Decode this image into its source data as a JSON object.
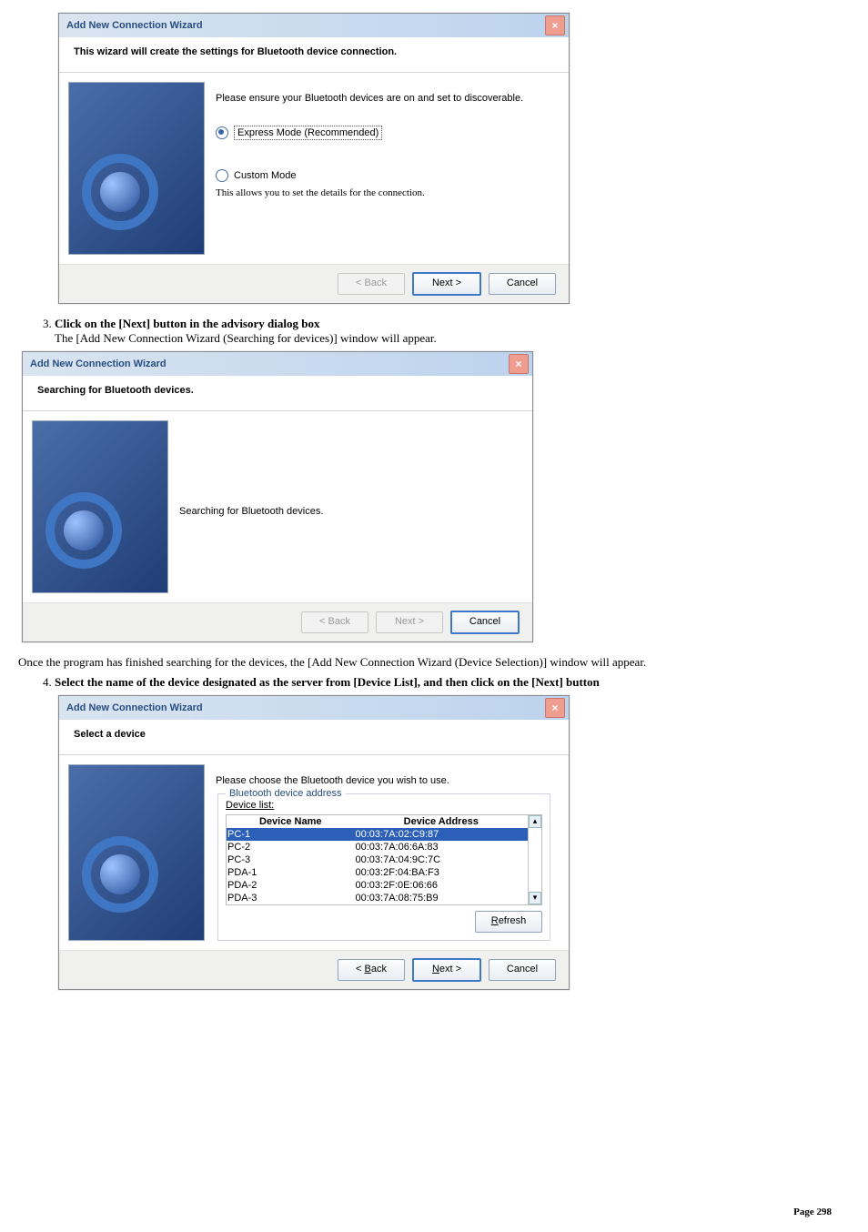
{
  "dialog1": {
    "title": "Add New Connection Wizard",
    "header": "This wizard will create the settings for Bluetooth device connection.",
    "instr": "Please ensure your Bluetooth devices are on and set to discoverable.",
    "opt_express": "Express Mode (Recommended)",
    "opt_custom": "Custom Mode",
    "opt_custom_sub": "This allows you to set the details for the connection.",
    "back": "< Back",
    "next": "Next >",
    "cancel": "Cancel"
  },
  "step3": {
    "bold": "Click on the [Next] button in the advisory dialog box",
    "sub": "The [Add New Connection Wizard (Searching for devices)] window will appear."
  },
  "dialog2": {
    "title": "Add New Connection Wizard",
    "header": "Searching for Bluetooth devices.",
    "body": "Searching for Bluetooth devices.",
    "back": "< Back",
    "next": "Next >",
    "cancel": "Cancel"
  },
  "mid": "Once the program has finished searching for the devices, the [Add New Connection Wizard (Device Selection)] window will appear.",
  "step4": {
    "bold": "Select the name of the device designated as the server from [Device List], and then click on the [Next] button"
  },
  "dialog3": {
    "title": "Add New Connection Wizard",
    "header": "Select a device",
    "instr": "Please choose the Bluetooth device you wish to use.",
    "group": "Bluetooth device address",
    "label": "Device list:",
    "col1": "Device Name",
    "col2": "Device Address",
    "rows": [
      {
        "n": "PC-1",
        "a": "00:03:7A:02:C9:87"
      },
      {
        "n": "PC-2",
        "a": "00:03:7A:06:6A:83"
      },
      {
        "n": "PC-3",
        "a": "00:03:7A:04:9C:7C"
      },
      {
        "n": "PDA-1",
        "a": "00:03:2F:04:BA:F3"
      },
      {
        "n": "PDA-2",
        "a": "00:03:2F:0E:06:66"
      },
      {
        "n": "PDA-3",
        "a": "00:03:7A:08:75:B9"
      }
    ],
    "refresh": "Refresh",
    "back": "< Back",
    "next": "Next >",
    "cancel": "Cancel"
  },
  "pageno": "Page 298"
}
